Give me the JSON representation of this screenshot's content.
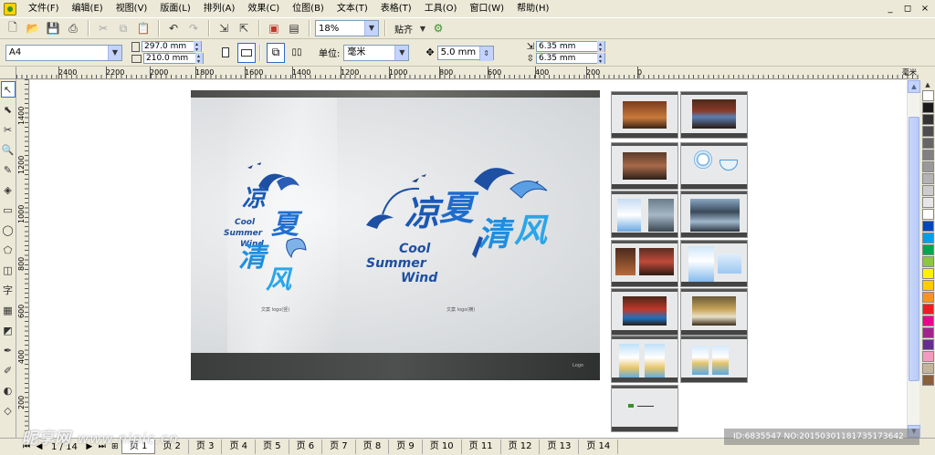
{
  "menu": {
    "items": [
      "文件(F)",
      "编辑(E)",
      "视图(V)",
      "版面(L)",
      "排列(A)",
      "效果(C)",
      "位图(B)",
      "文本(T)",
      "表格(T)",
      "工具(O)",
      "窗口(W)",
      "帮助(H)"
    ],
    "window_controls": [
      "_",
      "◻",
      "×"
    ]
  },
  "toolbar": {
    "zoom_value": "18%",
    "snap_label": "贴齐"
  },
  "propbar": {
    "paper_size": "A4",
    "width": "297.0 mm",
    "height": "210.0 mm",
    "unit_label": "单位:",
    "unit_value": "毫米",
    "nudge": "5.0 mm",
    "dup_x": "6.35 mm",
    "dup_y": "6.35 mm"
  },
  "hruler": {
    "ticks": [
      "2400",
      "2200",
      "2000",
      "1800",
      "1600",
      "1400",
      "1200",
      "1000",
      "800",
      "600",
      "400",
      "200",
      "0"
    ],
    "unit": "毫米"
  },
  "vruler": {
    "ticks": [
      "1400",
      "1200",
      "1000",
      "800",
      "600",
      "400",
      "200"
    ]
  },
  "canvas": {
    "big_logo_cn": "凉夏清风",
    "big_logo_en_1": "Cool",
    "big_logo_en_2": "Summer",
    "big_logo_en_3": "Wind",
    "caption_1": "文案 logo(竖)",
    "caption_2": "文案 logo(横)",
    "footer_logo": "Logo"
  },
  "pagetabs": {
    "count": "1 / 14",
    "tabs": [
      "页 1",
      "页 2",
      "页 3",
      "页 4",
      "页 5",
      "页 6",
      "页 7",
      "页 8",
      "页 9",
      "页 10",
      "页 11",
      "页 12",
      "页 13",
      "页 14"
    ]
  },
  "watermark": {
    "left_brand": "昵享网",
    "left_url": "www.nipic.cn",
    "right_id": "ID:6835547 NO:20150301181735173642"
  },
  "palette_colors": [
    "#ffffff",
    "#1a1a1a",
    "#333333",
    "#4d4d4d",
    "#666666",
    "#808080",
    "#999999",
    "#b3b3b3",
    "#cccccc",
    "#e6e6e6",
    "#ffffff",
    "#0047bb",
    "#00a0e9",
    "#00a651",
    "#8dc63f",
    "#fff200",
    "#ffcc00",
    "#f7941d",
    "#ed1c24",
    "#ec008c",
    "#a3238e",
    "#662d91",
    "#f49ac1",
    "#c2b59b",
    "#8b5e3c"
  ]
}
